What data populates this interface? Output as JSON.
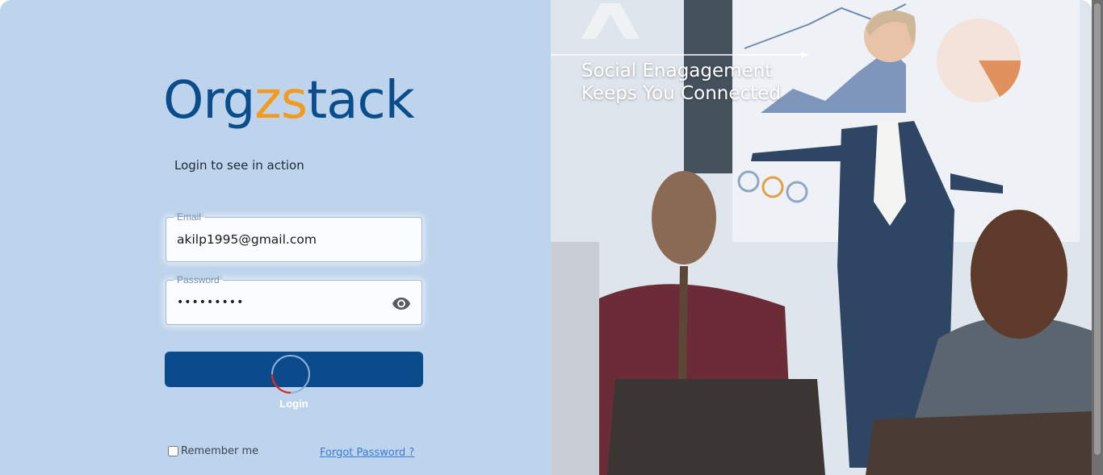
{
  "brand": {
    "prefix": "Org",
    "accent": "zs",
    "suffix": "tack",
    "primary_color": "#0a4d8c",
    "accent_color": "#f39a1f"
  },
  "tagline": "Login to see in action",
  "email": {
    "label": "Email",
    "value": "akilp1995@gmail.com"
  },
  "password": {
    "label": "Password",
    "value": "•••••••••",
    "toggle_icon": "eye-icon"
  },
  "login": {
    "label": "Login",
    "state": "loading"
  },
  "remember": {
    "label": "Remember me",
    "checked": false
  },
  "forgot": {
    "label": "Forgot Password ?"
  },
  "hero": {
    "line1": "Social Enagagement",
    "line2": "Keeps You Connected",
    "logo_icon": "orgzstack-mark-icon",
    "photo": "presenter-with-audience-image"
  }
}
